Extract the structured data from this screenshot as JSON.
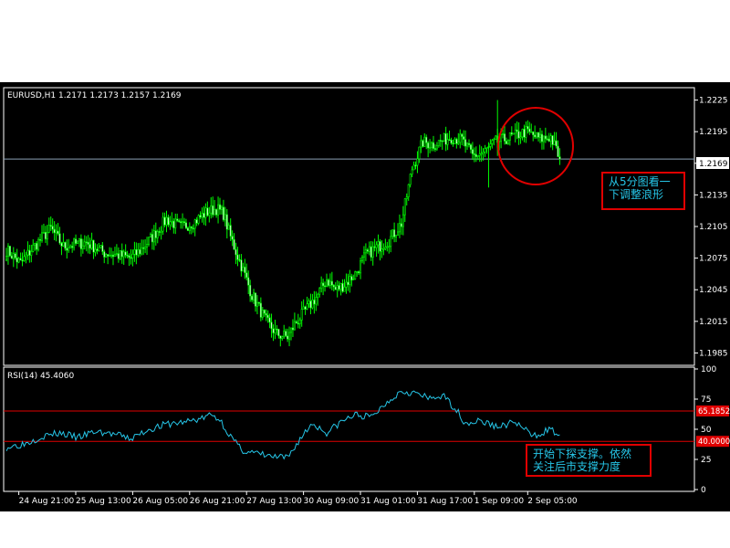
{
  "chart_data": [
    {
      "type": "candlestick",
      "title": "EURUSD,H1  1.2171 1.2173 1.2157 1.2169",
      "symbol": "EURUSD,H1",
      "ylim": [
        1.1975,
        1.2235
      ],
      "y_ticks": [
        "1.2225",
        "1.2195",
        "1.2165",
        "1.2135",
        "1.2105",
        "1.2075",
        "1.2045",
        "1.2015",
        "1.1985"
      ],
      "last_price": "1.2169",
      "series_color": "#00ff00",
      "price_anchors": [
        [
          0,
          1.2083
        ],
        [
          8,
          1.207
        ],
        [
          15,
          1.2085
        ],
        [
          25,
          1.2103
        ],
        [
          32,
          1.2086
        ],
        [
          45,
          1.209
        ],
        [
          55,
          1.208
        ],
        [
          62,
          1.2078
        ],
        [
          70,
          1.2075
        ],
        [
          75,
          1.2082
        ],
        [
          82,
          1.2095
        ],
        [
          90,
          1.2112
        ],
        [
          98,
          1.2104
        ],
        [
          106,
          1.211
        ],
        [
          112,
          1.2118
        ],
        [
          118,
          1.2122
        ],
        [
          122,
          1.2117
        ],
        [
          126,
          1.2095
        ],
        [
          132,
          1.2068
        ],
        [
          138,
          1.204
        ],
        [
          146,
          1.2015
        ],
        [
          152,
          1.2003
        ],
        [
          158,
          1.2
        ],
        [
          162,
          1.2012
        ],
        [
          168,
          1.2025
        ],
        [
          175,
          1.204
        ],
        [
          180,
          1.2055
        ],
        [
          185,
          1.2045
        ],
        [
          190,
          1.205
        ],
        [
          196,
          1.206
        ],
        [
          202,
          1.2078
        ],
        [
          208,
          1.2085
        ],
        [
          215,
          1.2092
        ],
        [
          222,
          1.2108
        ],
        [
          228,
          1.216
        ],
        [
          234,
          1.2185
        ],
        [
          240,
          1.2183
        ],
        [
          250,
          1.219
        ],
        [
          256,
          1.2187
        ],
        [
          262,
          1.2172
        ],
        [
          268,
          1.2175
        ],
        [
          275,
          1.2185
        ],
        [
          284,
          1.219
        ],
        [
          292,
          1.2195
        ],
        [
          300,
          1.2188
        ],
        [
          306,
          1.219
        ],
        [
          311,
          1.2169
        ]
      ],
      "horizontal_line": 1.2169
    },
    {
      "type": "line",
      "title": "RSI(14)  45.4060",
      "ylim": [
        0,
        100
      ],
      "y_ticks": [
        "100",
        "75",
        "50",
        "25",
        "0"
      ],
      "levels": [
        "65.1852",
        "40.0000"
      ],
      "level_values": [
        65.1852,
        40.0
      ],
      "series_color": "#26c6e8",
      "level_color": "#e00000",
      "rsi_anchors": [
        [
          0,
          35
        ],
        [
          10,
          38
        ],
        [
          20,
          44
        ],
        [
          30,
          47
        ],
        [
          40,
          43
        ],
        [
          50,
          48
        ],
        [
          60,
          46
        ],
        [
          70,
          42
        ],
        [
          80,
          50
        ],
        [
          90,
          54
        ],
        [
          100,
          56
        ],
        [
          110,
          59
        ],
        [
          115,
          62
        ],
        [
          120,
          58
        ],
        [
          126,
          44
        ],
        [
          132,
          33
        ],
        [
          140,
          30
        ],
        [
          150,
          27
        ],
        [
          158,
          26
        ],
        [
          165,
          42
        ],
        [
          172,
          55
        ],
        [
          180,
          47
        ],
        [
          188,
          56
        ],
        [
          196,
          62
        ],
        [
          205,
          60
        ],
        [
          215,
          74
        ],
        [
          222,
          82
        ],
        [
          230,
          80
        ],
        [
          238,
          75
        ],
        [
          245,
          78
        ],
        [
          252,
          68
        ],
        [
          258,
          55
        ],
        [
          266,
          57
        ],
        [
          276,
          52
        ],
        [
          286,
          56
        ],
        [
          296,
          44
        ],
        [
          305,
          50
        ],
        [
          311,
          45.4
        ]
      ]
    }
  ],
  "x_axis": {
    "labels": [
      "24 Aug 21:00",
      "25 Aug 13:00",
      "26 Aug 05:00",
      "26 Aug 21:00",
      "27 Aug 13:00",
      "30 Aug 09:00",
      "31 Aug 01:00",
      "31 Aug 17:00",
      "1 Sep 09:00",
      "2 Sep 05:00"
    ],
    "label_bars": [
      8,
      40,
      72,
      104,
      136,
      168,
      200,
      232,
      264,
      294
    ]
  },
  "annotations": {
    "note1": [
      "从5分图看一",
      "下调整浪形"
    ],
    "note2": [
      "开始下探支撑。依然",
      "关注后市支撑力度"
    ]
  }
}
